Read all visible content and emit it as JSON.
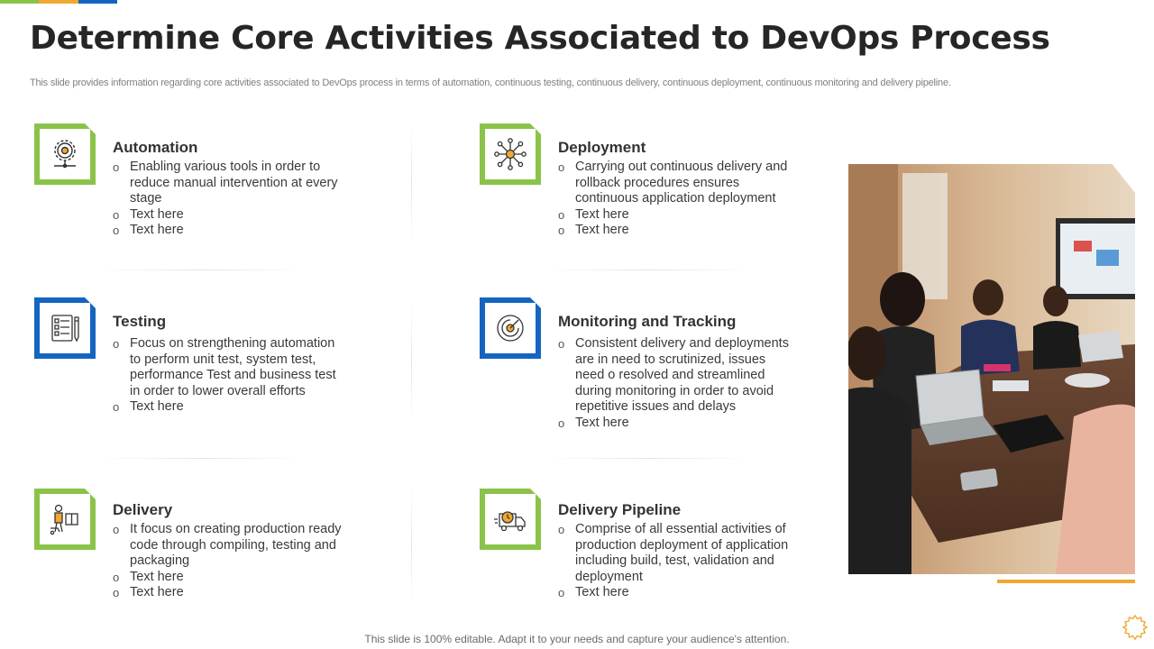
{
  "colors": {
    "green": "#8bc34a",
    "blue": "#1565c0",
    "orange": "#f0a830",
    "title": "#262626"
  },
  "header": {
    "title": "Determine Core Activities Associated to DevOps Process",
    "subtitle": "This slide provides information regarding core activities associated to DevOps process in terms of automation, continuous testing, continuous delivery, continuous deployment, continuous monitoring and delivery pipeline."
  },
  "cards": [
    {
      "title": "Automation",
      "icon": "gear-network-icon",
      "bullets": [
        "Enabling various tools in order to reduce manual intervention at every stage",
        "Text here",
        "Text here"
      ]
    },
    {
      "title": "Deployment",
      "icon": "hub-nodes-icon",
      "bullets": [
        "Carrying out continuous delivery and rollback procedures ensures continuous application deployment",
        "Text here",
        "Text here"
      ]
    },
    {
      "title": "Testing",
      "icon": "checklist-icon",
      "bullets": [
        "Focus on strengthening automation to perform unit test, system test, performance Test and business test in order to lower overall efforts",
        "Text here"
      ]
    },
    {
      "title": "Monitoring and Tracking",
      "icon": "radar-icon",
      "bullets": [
        "Consistent delivery and deployments are in need to scrutinized, issues need o resolved and streamlined during monitoring in order to avoid repetitive issues and delays",
        "Text here"
      ]
    },
    {
      "title": "Delivery",
      "icon": "delivery-worker-icon",
      "bullets": [
        "It focus on creating production ready code through compiling, testing and packaging",
        "Text here",
        "Text here"
      ]
    },
    {
      "title": "Delivery Pipeline",
      "icon": "delivery-truck-clock-icon",
      "bullets": [
        "Comprise of all essential activities of production deployment of application including build, test, validation and deployment",
        "Text here"
      ]
    }
  ],
  "footer": {
    "text": "This slide is 100% editable. Adapt it to your needs and capture your audience's attention."
  }
}
